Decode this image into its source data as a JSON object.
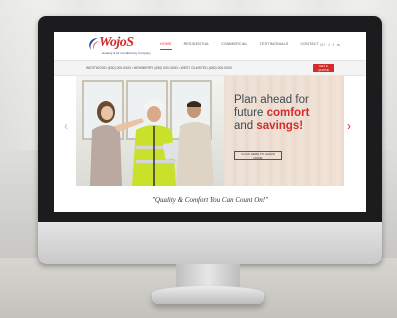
{
  "site": {
    "logo_text": "WojoS",
    "logo_tagline": "Heating & Air Conditioning Company"
  },
  "nav": {
    "items": [
      {
        "label": "HOME",
        "active": true
      },
      {
        "label": "RESIDENTIAL",
        "active": false
      },
      {
        "label": "COMMERCIAL",
        "active": false
      },
      {
        "label": "TESTIMONIALS",
        "active": false
      },
      {
        "label": "CONTACT",
        "active": false
      }
    ]
  },
  "social": [
    "G+",
    "t",
    "f",
    "in"
  ],
  "contact_bar": {
    "phones": "WESTWOOD (630) 000-0000  •  NEWBERRY (630) 000-0000  •  WEST OLMSTED (630) 000-0000",
    "quote_button": "GET A QUOTE"
  },
  "hero": {
    "line1": "Plan ahead for",
    "line2_plain": "future ",
    "line2_highlight": "comfort",
    "line3_plain": "and ",
    "line3_highlight": "savings!",
    "button": "CLICK HERE TO LEARN MORE",
    "prev_arrow": "‹",
    "next_arrow": "›"
  },
  "tagline": "\"Quality & Comfort You Can Count On!\"",
  "colors": {
    "brand_red": "#d42b2b",
    "brand_blue": "#2b4d8f",
    "hero_text": "#3e4a52"
  }
}
